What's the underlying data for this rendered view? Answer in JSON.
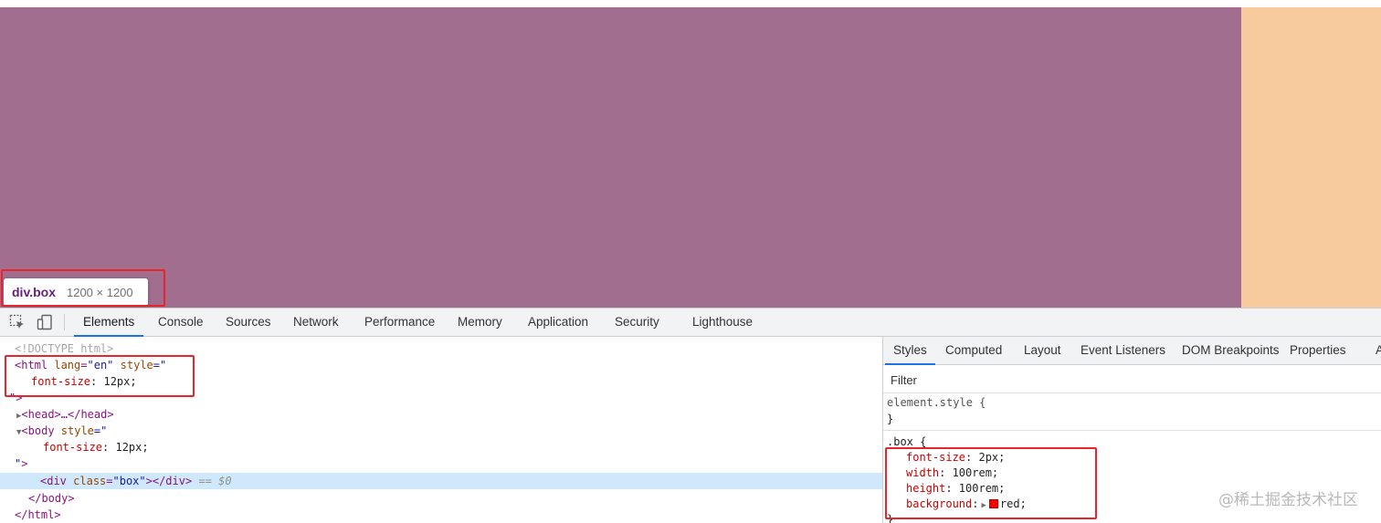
{
  "page": {
    "box_color": "#a16e8f",
    "margin_color": "#f7cb9d",
    "tooltip": {
      "tag": "div",
      "class": ".box",
      "dimensions": "1200 × 1200"
    }
  },
  "devtools": {
    "toolbar_icons": [
      "inspect-element-icon",
      "device-toggle-icon"
    ],
    "tabs": [
      "Elements",
      "Console",
      "Sources",
      "Network",
      "Performance",
      "Memory",
      "Application",
      "Security",
      "Lighthouse"
    ],
    "active_tab": "Elements",
    "dom": {
      "doctype": "<!DOCTYPE html>",
      "html_open": "<html",
      "html_lang_attr": "lang",
      "html_lang_val": "\"en\"",
      "html_style_attr": "style",
      "html_style_open": "=\"",
      "html_font_prop": "font-size",
      "html_font_val": ": 12px;",
      "close_quote": "\"",
      "gt": ">",
      "head": "<head>…</head>",
      "body_open": "<body",
      "body_style_attr": "style",
      "body_font_prop": "font-size",
      "body_font_val": ": 12px;",
      "quote_gt": "\">",
      "div_open": "<div",
      "div_class_attr": "class",
      "div_class_val": "\"box\"",
      "div_close": "></div>",
      "div_marker": "== $0",
      "body_close": "</body>",
      "html_close": "</html>"
    },
    "styles": {
      "tabs": [
        "Styles",
        "Computed",
        "Layout",
        "Event Listeners",
        "DOM Breakpoints",
        "Properties",
        "A"
      ],
      "active_tab": "Styles",
      "filter_placeholder": "Filter",
      "element_style_selector": "element.style {",
      "element_style_close": "}",
      "box_selector": ".box {",
      "box_props": [
        {
          "name": "font-size",
          "value": ": 2px;"
        },
        {
          "name": "width",
          "value": ": 100rem;"
        },
        {
          "name": "height",
          "value": ": 100rem;"
        },
        {
          "name": "background",
          "value": "red;"
        }
      ],
      "swatch_color": "#ff0000",
      "box_close": "}"
    }
  },
  "watermark": "@稀土掘金技术社区"
}
